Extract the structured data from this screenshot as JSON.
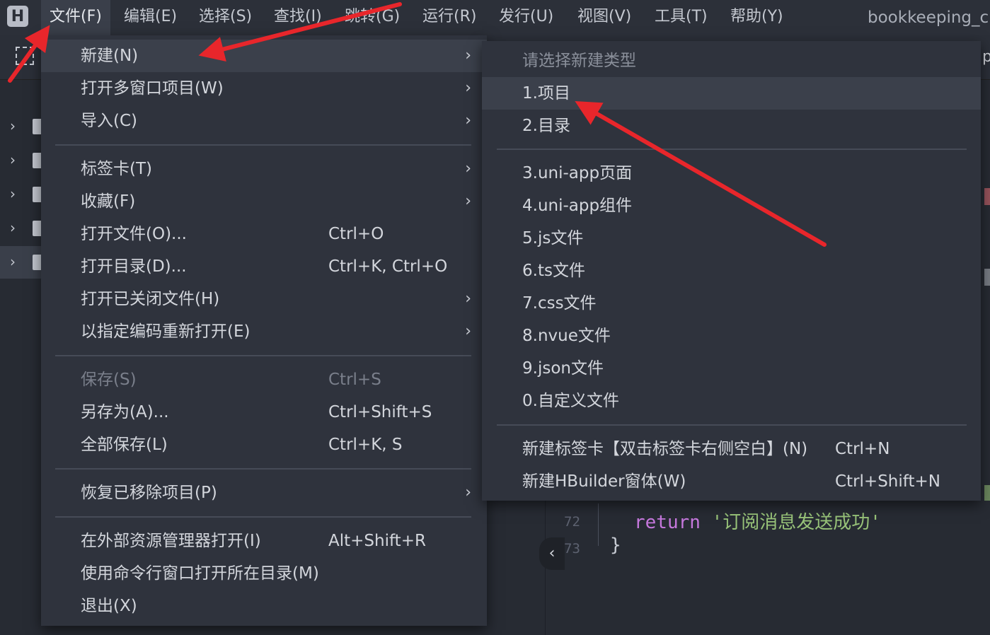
{
  "menubar": {
    "logo": "H",
    "items": [
      {
        "label": "文件(F)"
      },
      {
        "label": "编辑(E)"
      },
      {
        "label": "选择(S)"
      },
      {
        "label": "查找(I)"
      },
      {
        "label": "跳转(G)"
      },
      {
        "label": "运行(R)"
      },
      {
        "label": "发行(U)"
      },
      {
        "label": "视图(V)"
      },
      {
        "label": "工具(T)"
      },
      {
        "label": "帮助(Y)"
      }
    ],
    "window_title": "bookkeeping_c"
  },
  "toolbar": {
    "tab_fragment": "p"
  },
  "file_menu": {
    "items": [
      {
        "label": "新建(N)",
        "shortcut": "",
        "submenu": "›"
      },
      {
        "label": "打开多窗口项目(W)",
        "shortcut": "",
        "submenu": "›"
      },
      {
        "label": "导入(C)",
        "shortcut": "",
        "submenu": "›"
      },
      {
        "label": "标签卡(T)",
        "shortcut": "",
        "submenu": "›"
      },
      {
        "label": "收藏(F)",
        "shortcut": "",
        "submenu": "›"
      },
      {
        "label": "打开文件(O)...",
        "shortcut": "Ctrl+O",
        "submenu": ""
      },
      {
        "label": "打开目录(D)...",
        "shortcut": "Ctrl+K, Ctrl+O",
        "submenu": ""
      },
      {
        "label": "打开已关闭文件(H)",
        "shortcut": "",
        "submenu": "›"
      },
      {
        "label": "以指定编码重新打开(E)",
        "shortcut": "",
        "submenu": "›"
      },
      {
        "label": "保存(S)",
        "shortcut": "Ctrl+S",
        "submenu": "",
        "disabled": true
      },
      {
        "label": "另存为(A)...",
        "shortcut": "Ctrl+Shift+S",
        "submenu": ""
      },
      {
        "label": "全部保存(L)",
        "shortcut": "Ctrl+K, S",
        "submenu": ""
      },
      {
        "label": "恢复已移除项目(P)",
        "shortcut": "",
        "submenu": "›"
      },
      {
        "label": "在外部资源管理器打开(I)",
        "shortcut": "Alt+Shift+R",
        "submenu": ""
      },
      {
        "label": "使用命令行窗口打开所在目录(M)",
        "shortcut": "",
        "submenu": ""
      },
      {
        "label": "退出(X)",
        "shortcut": "",
        "submenu": ""
      }
    ]
  },
  "new_menu": {
    "header": "请选择新建类型",
    "items": [
      {
        "label": "1.项目",
        "shortcut": ""
      },
      {
        "label": "2.目录",
        "shortcut": ""
      },
      {
        "label": "3.uni-app页面",
        "shortcut": ""
      },
      {
        "label": "4.uni-app组件",
        "shortcut": ""
      },
      {
        "label": "5.js文件",
        "shortcut": ""
      },
      {
        "label": "6.ts文件",
        "shortcut": ""
      },
      {
        "label": "7.css文件",
        "shortcut": ""
      },
      {
        "label": "8.nvue文件",
        "shortcut": ""
      },
      {
        "label": "9.json文件",
        "shortcut": ""
      },
      {
        "label": "0.自定义文件",
        "shortcut": ""
      },
      {
        "label": "新建标签卡【双击标签卡右侧空白】(N)",
        "shortcut": "Ctrl+N"
      },
      {
        "label": "新建HBuilder窗体(W)",
        "shortcut": "Ctrl+Shift+N"
      }
    ]
  },
  "editor": {
    "lines": [
      {
        "number": "72",
        "keyword": "return",
        "string": "'订阅消息发送成功'"
      },
      {
        "number": "73",
        "punct": "}"
      }
    ],
    "collapse_glyph": "‹"
  },
  "colors": {
    "annotation_arrow": "#e8262b",
    "menu_bg": "#2f333d",
    "hover_bg": "#3b404b",
    "keyword": "#c678dd",
    "string": "#98c379"
  }
}
